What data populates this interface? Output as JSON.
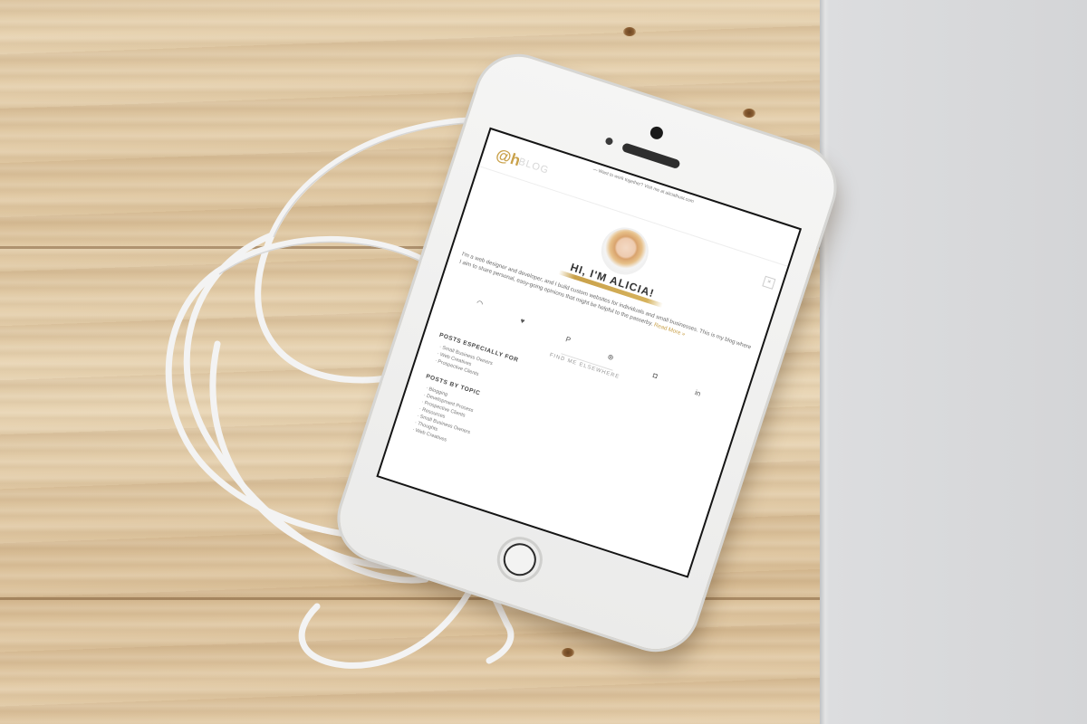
{
  "screen": {
    "top_notice": "— Want to work together? Visit me at alicialhust.com",
    "logo": "@h",
    "logo_sub": "BLOG",
    "close_label": "×",
    "greeting": "HI, I'M ALICIA!",
    "intro": "I'm a web designer and developer, and I build custom websites for individuals and small businesses. This is my blog where I aim to share personal, easy-going opinions that might be helpful to the passerby.",
    "read_more": "Read More »",
    "find_me": "FIND ME ELSEWHERE",
    "icons": [
      "rss-icon",
      "twitter-icon",
      "pinterest-icon",
      "dribbble-icon",
      "instagram-icon",
      "linkedin-icon"
    ],
    "icon_glyphs": [
      "◠",
      "♥",
      "P",
      "⊛",
      "◘",
      "in"
    ],
    "posts_for": {
      "title": "POSTS ESPECIALLY FOR",
      "items": [
        "Small Business Owners",
        "Web Creatives",
        "Prospective Clients"
      ]
    },
    "posts_topic": {
      "title": "POSTS BY TOPIC",
      "items": [
        "Blogging",
        "Development Process",
        "Prospective Clients",
        "Resources",
        "Small Business Owners",
        "Thoughts",
        "Web Creatives"
      ]
    }
  },
  "colors": {
    "accent": "#c9a14a",
    "wood": "#dcc39c",
    "laptop": "#d8d9db"
  }
}
